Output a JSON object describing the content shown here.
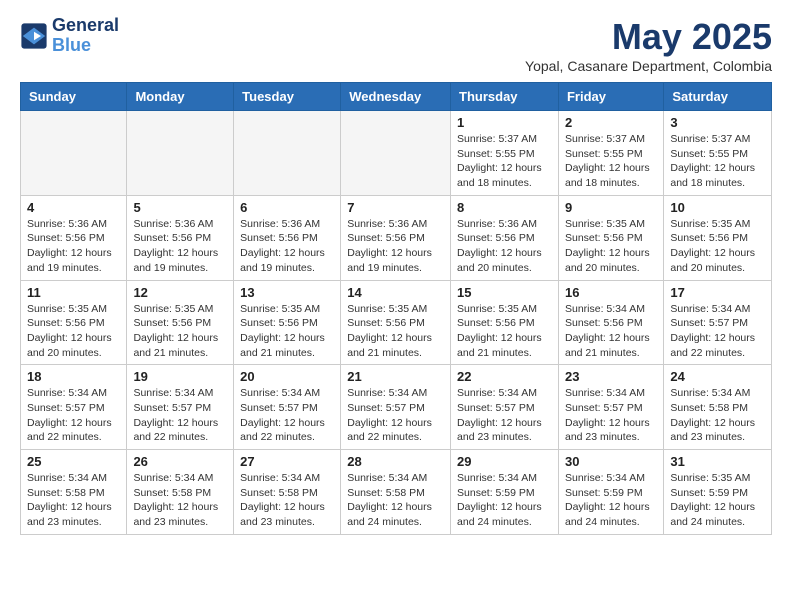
{
  "header": {
    "logo_line1": "General",
    "logo_line2": "Blue",
    "month_title": "May 2025",
    "location": "Yopal, Casanare Department, Colombia"
  },
  "weekdays": [
    "Sunday",
    "Monday",
    "Tuesday",
    "Wednesday",
    "Thursday",
    "Friday",
    "Saturday"
  ],
  "weeks": [
    [
      {
        "day": "",
        "info": ""
      },
      {
        "day": "",
        "info": ""
      },
      {
        "day": "",
        "info": ""
      },
      {
        "day": "",
        "info": ""
      },
      {
        "day": "1",
        "info": "Sunrise: 5:37 AM\nSunset: 5:55 PM\nDaylight: 12 hours\nand 18 minutes."
      },
      {
        "day": "2",
        "info": "Sunrise: 5:37 AM\nSunset: 5:55 PM\nDaylight: 12 hours\nand 18 minutes."
      },
      {
        "day": "3",
        "info": "Sunrise: 5:37 AM\nSunset: 5:55 PM\nDaylight: 12 hours\nand 18 minutes."
      }
    ],
    [
      {
        "day": "4",
        "info": "Sunrise: 5:36 AM\nSunset: 5:56 PM\nDaylight: 12 hours\nand 19 minutes."
      },
      {
        "day": "5",
        "info": "Sunrise: 5:36 AM\nSunset: 5:56 PM\nDaylight: 12 hours\nand 19 minutes."
      },
      {
        "day": "6",
        "info": "Sunrise: 5:36 AM\nSunset: 5:56 PM\nDaylight: 12 hours\nand 19 minutes."
      },
      {
        "day": "7",
        "info": "Sunrise: 5:36 AM\nSunset: 5:56 PM\nDaylight: 12 hours\nand 19 minutes."
      },
      {
        "day": "8",
        "info": "Sunrise: 5:36 AM\nSunset: 5:56 PM\nDaylight: 12 hours\nand 20 minutes."
      },
      {
        "day": "9",
        "info": "Sunrise: 5:35 AM\nSunset: 5:56 PM\nDaylight: 12 hours\nand 20 minutes."
      },
      {
        "day": "10",
        "info": "Sunrise: 5:35 AM\nSunset: 5:56 PM\nDaylight: 12 hours\nand 20 minutes."
      }
    ],
    [
      {
        "day": "11",
        "info": "Sunrise: 5:35 AM\nSunset: 5:56 PM\nDaylight: 12 hours\nand 20 minutes."
      },
      {
        "day": "12",
        "info": "Sunrise: 5:35 AM\nSunset: 5:56 PM\nDaylight: 12 hours\nand 21 minutes."
      },
      {
        "day": "13",
        "info": "Sunrise: 5:35 AM\nSunset: 5:56 PM\nDaylight: 12 hours\nand 21 minutes."
      },
      {
        "day": "14",
        "info": "Sunrise: 5:35 AM\nSunset: 5:56 PM\nDaylight: 12 hours\nand 21 minutes."
      },
      {
        "day": "15",
        "info": "Sunrise: 5:35 AM\nSunset: 5:56 PM\nDaylight: 12 hours\nand 21 minutes."
      },
      {
        "day": "16",
        "info": "Sunrise: 5:34 AM\nSunset: 5:56 PM\nDaylight: 12 hours\nand 21 minutes."
      },
      {
        "day": "17",
        "info": "Sunrise: 5:34 AM\nSunset: 5:57 PM\nDaylight: 12 hours\nand 22 minutes."
      }
    ],
    [
      {
        "day": "18",
        "info": "Sunrise: 5:34 AM\nSunset: 5:57 PM\nDaylight: 12 hours\nand 22 minutes."
      },
      {
        "day": "19",
        "info": "Sunrise: 5:34 AM\nSunset: 5:57 PM\nDaylight: 12 hours\nand 22 minutes."
      },
      {
        "day": "20",
        "info": "Sunrise: 5:34 AM\nSunset: 5:57 PM\nDaylight: 12 hours\nand 22 minutes."
      },
      {
        "day": "21",
        "info": "Sunrise: 5:34 AM\nSunset: 5:57 PM\nDaylight: 12 hours\nand 22 minutes."
      },
      {
        "day": "22",
        "info": "Sunrise: 5:34 AM\nSunset: 5:57 PM\nDaylight: 12 hours\nand 23 minutes."
      },
      {
        "day": "23",
        "info": "Sunrise: 5:34 AM\nSunset: 5:57 PM\nDaylight: 12 hours\nand 23 minutes."
      },
      {
        "day": "24",
        "info": "Sunrise: 5:34 AM\nSunset: 5:58 PM\nDaylight: 12 hours\nand 23 minutes."
      }
    ],
    [
      {
        "day": "25",
        "info": "Sunrise: 5:34 AM\nSunset: 5:58 PM\nDaylight: 12 hours\nand 23 minutes."
      },
      {
        "day": "26",
        "info": "Sunrise: 5:34 AM\nSunset: 5:58 PM\nDaylight: 12 hours\nand 23 minutes."
      },
      {
        "day": "27",
        "info": "Sunrise: 5:34 AM\nSunset: 5:58 PM\nDaylight: 12 hours\nand 23 minutes."
      },
      {
        "day": "28",
        "info": "Sunrise: 5:34 AM\nSunset: 5:58 PM\nDaylight: 12 hours\nand 24 minutes."
      },
      {
        "day": "29",
        "info": "Sunrise: 5:34 AM\nSunset: 5:59 PM\nDaylight: 12 hours\nand 24 minutes."
      },
      {
        "day": "30",
        "info": "Sunrise: 5:34 AM\nSunset: 5:59 PM\nDaylight: 12 hours\nand 24 minutes."
      },
      {
        "day": "31",
        "info": "Sunrise: 5:35 AM\nSunset: 5:59 PM\nDaylight: 12 hours\nand 24 minutes."
      }
    ]
  ]
}
